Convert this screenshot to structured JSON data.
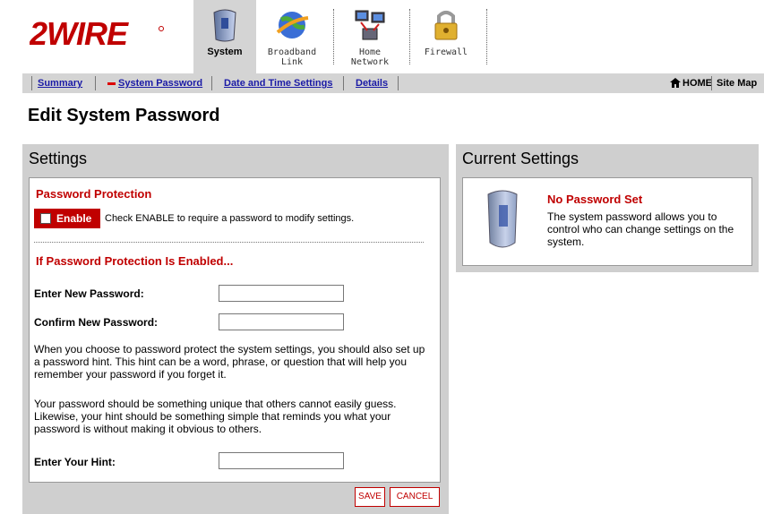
{
  "brand": {
    "logo_text": "2WIRE"
  },
  "nav": {
    "tabs": [
      {
        "label": "System",
        "icon": "system-icon",
        "active": true
      },
      {
        "label": "Broadband\nLink",
        "icon": "broadband-globe-icon",
        "active": false
      },
      {
        "label": "Home\nNetwork",
        "icon": "home-network-icon",
        "active": false
      },
      {
        "label": "Firewall",
        "icon": "firewall-lock-icon",
        "active": false
      }
    ]
  },
  "subnav": {
    "links": [
      "Summary",
      "System Password",
      "Date and Time Settings",
      "Details"
    ],
    "home_label": "HOME",
    "sitemap_label": "Site Map"
  },
  "page": {
    "title": "Edit System Password"
  },
  "settings": {
    "panel_title": "Settings",
    "protection_title": "Password Protection",
    "enable_label": "Enable",
    "enable_checked": false,
    "enable_help": "Check ENABLE to require a password to modify settings.",
    "enabled_section_title": "If Password Protection Is Enabled...",
    "new_password_label": "Enter New Password:",
    "confirm_password_label": "Confirm New Password:",
    "new_password_value": "",
    "confirm_password_value": "",
    "para1": "When you choose to password protect the system settings, you should also set up a password hint. This hint can be a word, phrase, or question that will help you remember your password if you forget it.",
    "para2": "Your password should be something unique that others cannot easily guess. Likewise, your hint should be something simple that reminds you what your password is without making it obvious to others.",
    "hint_label": "Enter Your Hint:",
    "hint_value": "",
    "save_label": "SAVE",
    "cancel_label": "CANCEL"
  },
  "current": {
    "panel_title": "Current Settings",
    "status_title": "No Password Set",
    "status_text": "The system password allows you to control who can change settings on the system."
  },
  "colors": {
    "accent_red": "#c00000",
    "panel_gray": "#cfcfcf",
    "link_blue": "#1a1aa6"
  }
}
